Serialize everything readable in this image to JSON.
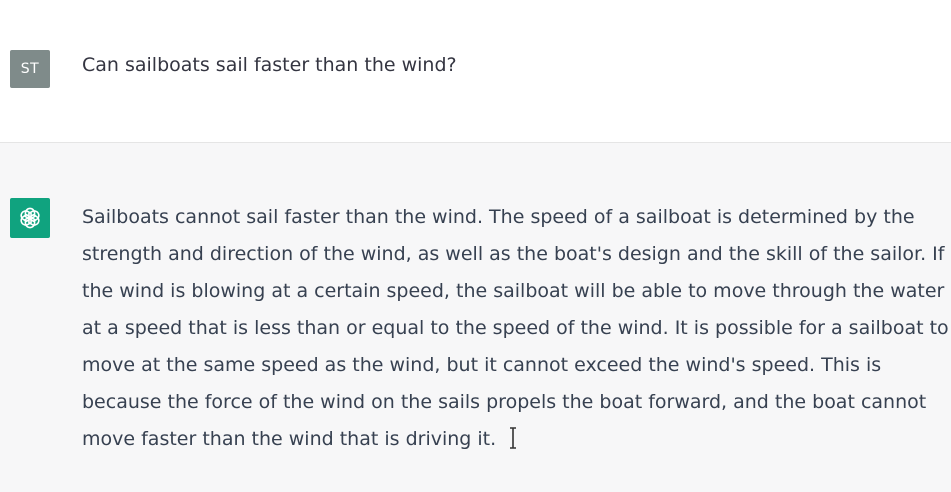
{
  "user_message": {
    "avatar_initials": "ST",
    "text": "Can sailboats sail faster than the wind?"
  },
  "assistant_message": {
    "avatar_icon": "openai-logo-icon",
    "lines": [
      "Sailboats cannot sail faster than the wind. The speed of a sailboat is determined by the",
      "strength and direction of the wind, as well as the boat's design and the skill of the sailor. If",
      "the wind is blowing at a certain speed, the sailboat will be able to move through the water",
      "at a speed that is less than or equal to the speed of the wind. It is possible for a sailboat to",
      "move at the same speed as the wind, but it cannot exceed the wind's speed. This is",
      "because the force of the wind on the sails propels the boat forward, and the boat cannot",
      "move faster than the wind that is driving it."
    ]
  },
  "colors": {
    "user_row_bg": "#ffffff",
    "assistant_row_bg": "#f7f7f8",
    "user_avatar_bg": "#7f8b8a",
    "bot_avatar_bg": "#10a37f",
    "text": "#374151"
  }
}
